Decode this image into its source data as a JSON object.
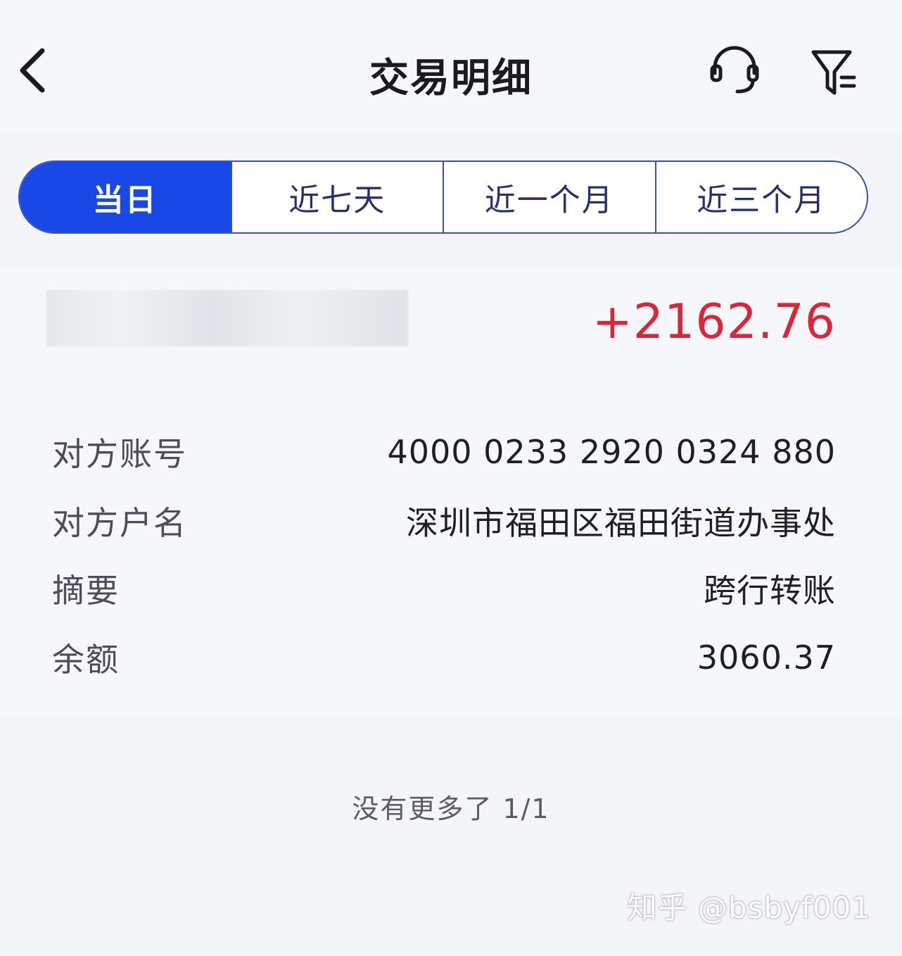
{
  "header": {
    "title": "交易明细"
  },
  "tabs": [
    {
      "label": "当日",
      "active": true
    },
    {
      "label": "近七天",
      "active": false
    },
    {
      "label": "近一个月",
      "active": false
    },
    {
      "label": "近三个月",
      "active": false
    }
  ],
  "transaction": {
    "amount": "+2162.76",
    "details": [
      {
        "label": "对方账号",
        "value": "4000 0233 2920 0324 880"
      },
      {
        "label": "对方户名",
        "value": "深圳市福田区福田街道办事处"
      },
      {
        "label": "摘要",
        "value": "跨行转账"
      },
      {
        "label": "余额",
        "value": "3060.37"
      }
    ]
  },
  "footer": {
    "text": "没有更多了 1/1"
  },
  "watermark": "知乎 @bsbyf001",
  "colors": {
    "accent": "#1849e6",
    "amount": "#d8263a",
    "border": "#3a4fbd"
  }
}
